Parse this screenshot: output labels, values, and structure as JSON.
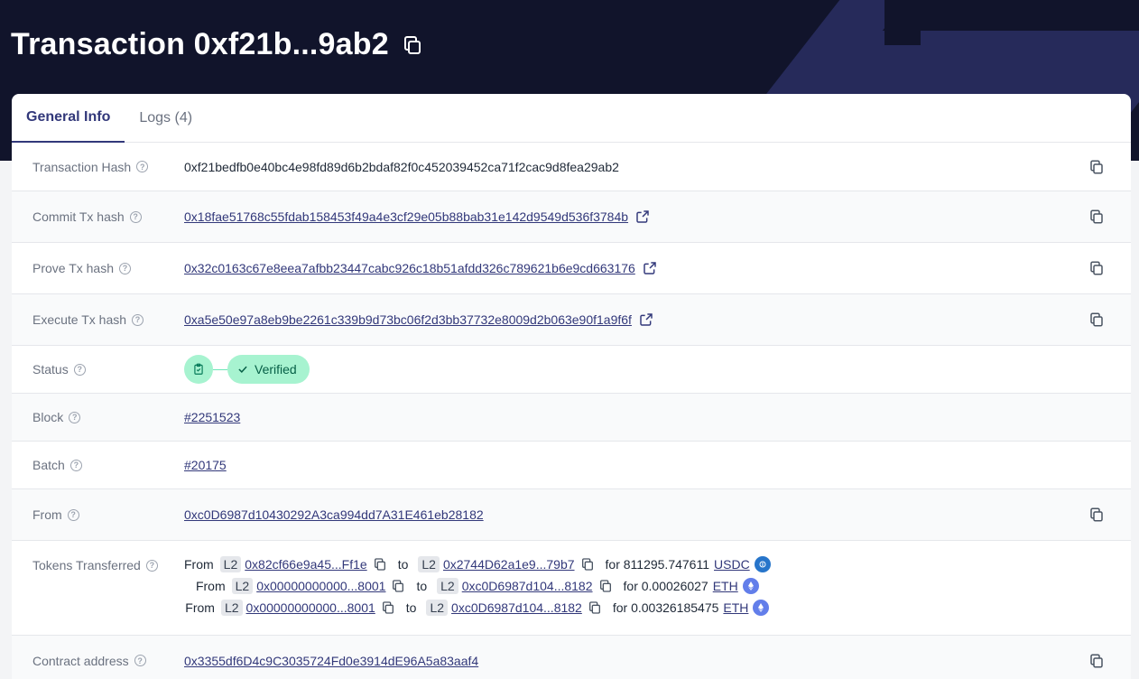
{
  "header": {
    "title": "Transaction 0xf21b...9ab2"
  },
  "tabs": [
    {
      "label": "General Info",
      "active": true
    },
    {
      "label": "Logs (4)",
      "active": false
    }
  ],
  "rows": {
    "tx_hash": {
      "label": "Transaction Hash",
      "value": "0xf21bedfb0e40bc4e98fd89d6b2bdaf82f0c452039452ca71f2cac9d8fea29ab2"
    },
    "commit": {
      "label": "Commit Tx hash",
      "value": "0x18fae51768c55fdab158453f49a4e3cf29e05b88bab31e142d9549d536f3784b"
    },
    "prove": {
      "label": "Prove Tx hash",
      "value": "0x32c0163c67e8eea7afbb23447cabc926c18b51afdd326c789621b6e9cd663176"
    },
    "execute": {
      "label": "Execute Tx hash",
      "value": "0xa5e50e97a8eb9be2261c339b9d73bc06f2d3bb37732e8009d2b063e90f1a9f6f"
    },
    "status": {
      "label": "Status",
      "value": "Verified"
    },
    "block": {
      "label": "Block",
      "value": "#2251523"
    },
    "batch": {
      "label": "Batch",
      "value": "#20175"
    },
    "from": {
      "label": "From",
      "value": "0xc0D6987d10430292A3ca994dd7A31E461eb28182"
    },
    "tokens": {
      "label": "Tokens Transferred",
      "from_word": "From",
      "to_word": "to",
      "network": "L2",
      "items": [
        {
          "from": "0x82cf66e9a45...Ff1e",
          "to": "0x2744D62a1e9...79b7",
          "amount": "for 811295.747611",
          "symbol": "USDC"
        },
        {
          "from": "0x00000000000...8001",
          "to": "0xc0D6987d104...8182",
          "amount": "for 0.00026027",
          "symbol": "ETH"
        },
        {
          "from": "0x00000000000...8001",
          "to": "0xc0D6987d104...8182",
          "amount": "for 0.00326185475",
          "symbol": "ETH"
        }
      ]
    },
    "contract": {
      "label": "Contract address",
      "value": "0x3355df6D4c9C3035724Fd0e3914dE96A5a83aaf4"
    }
  },
  "colors": {
    "header_bg": "#11142b",
    "accent": "#32387a",
    "verified_bg": "#a7f3d0",
    "usdc": "#2775ca",
    "eth": "#627eea"
  },
  "icons": {
    "copy": "copy-icon",
    "external": "external-link-icon",
    "help": "help-circle-icon",
    "status": "clipboard-check-icon",
    "check": "check-icon"
  }
}
